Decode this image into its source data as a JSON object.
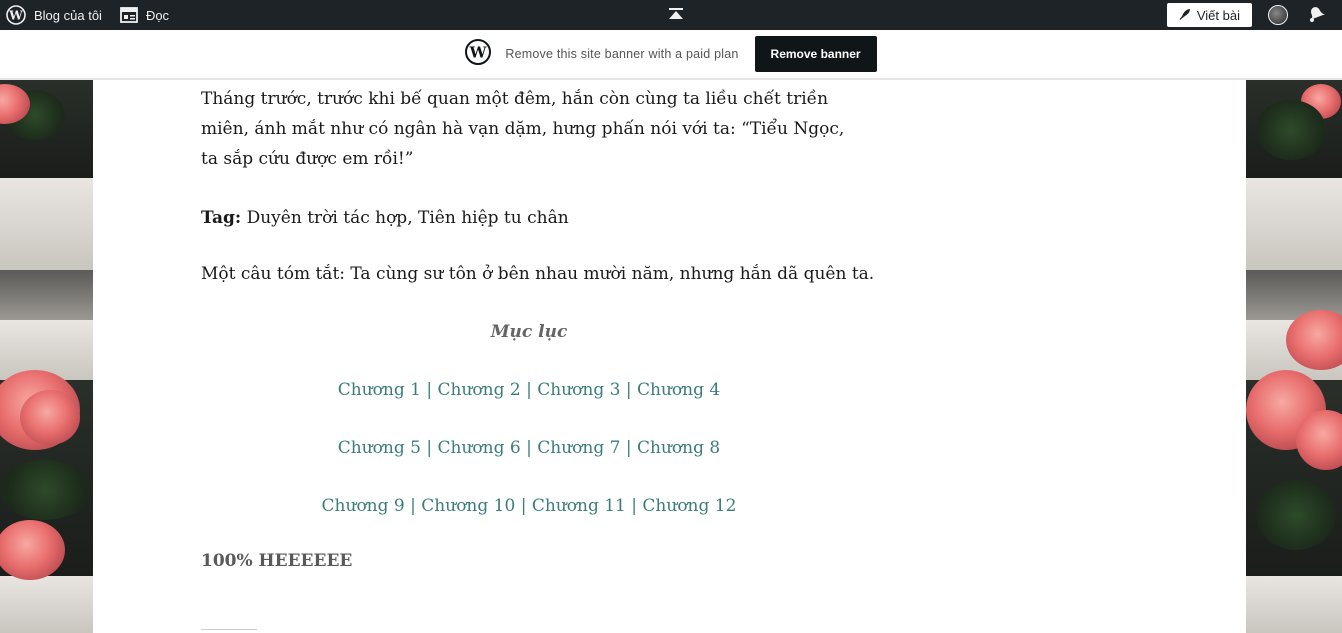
{
  "adminbar": {
    "my_blog": "Blog của tôi",
    "reader": "Đọc",
    "write": "Viết bài"
  },
  "banner": {
    "text": "Remove this site banner with a paid plan",
    "button": "Remove banner"
  },
  "post": {
    "intro": "Tháng trước, trước khi bế quan một đêm, hắn còn cùng ta liều chết triền miên, ánh mắt như có ngân hà vạn dặm, hưng phấn nói với ta: “Tiểu Ngọc, ta sắp cứu được em rồi!”",
    "tag_label": "Tag:",
    "tag_value": " Duyên trời tác hợp, Tiên hiệp tu chân",
    "summary": "Một câu tóm tắt: Ta cùng sư tôn ở bên nhau mười năm, nhưng hắn dã quên ta.",
    "toc_title": "Mục lục",
    "toc_rows": [
      [
        "Chương 1",
        "Chương 2",
        "Chương 3",
        "Chương 4"
      ],
      [
        "Chương 5",
        "Chương 6",
        "Chương 7",
        "Chương 8"
      ],
      [
        "Chương 9",
        "Chương 10",
        "Chương 11",
        "Chương 12"
      ]
    ],
    "toc_separator": " | ",
    "ending": "100% HEEEEEE"
  },
  "colors": {
    "adminbar_bg": "#1d2327",
    "link": "#3c7d7c",
    "banner_button_bg": "#101517"
  }
}
